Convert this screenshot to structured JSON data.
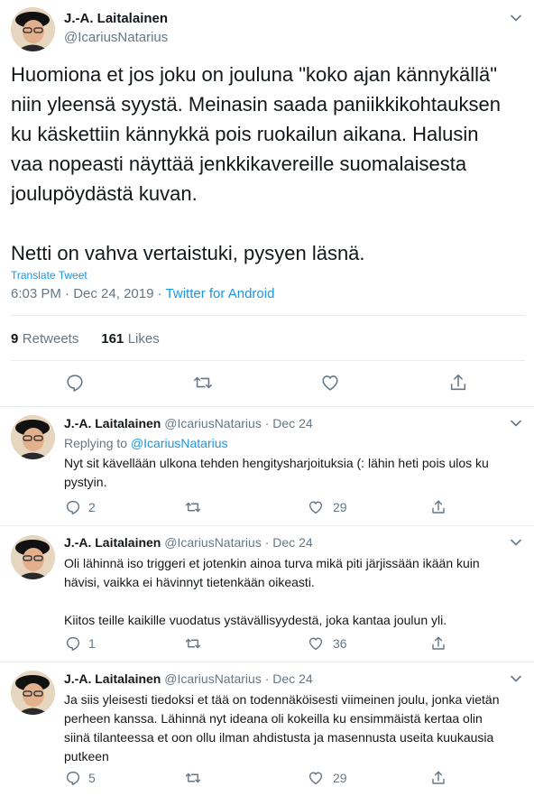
{
  "main_tweet": {
    "author_name": "J.-A. Laitalainen",
    "author_handle": "@IcariusNatarius",
    "text": "Huomiona et jos joku on jouluna \"koko ajan kännykällä\"\nniin yleensä syystä. Meinasin saada paniikkikohtauksen\nku käskettiin kännykkä pois ruokailun aikana. Halusin\nvaa nopeasti näyttää jenkkikavereille suomalaisesta\njoulupöydästä kuvan.\n\nNetti on vahva vertaistuki, pysyen läsnä.",
    "translate_label": "Translate Tweet",
    "time": "6:03 PM",
    "date": "Dec 24, 2019",
    "source": "Twitter for Android",
    "retweets_count": "9",
    "retweets_label": "Retweets",
    "likes_count": "161",
    "likes_label": "Likes"
  },
  "replies": [
    {
      "author_name": "J.-A. Laitalainen",
      "author_handle": "@IcariusNatarius",
      "date": "Dec 24",
      "replying_label": "Replying to",
      "replying_handle": "@IcariusNatarius",
      "text": "Nyt sit kävellään ulkona tehden hengitysharjoituksia (: lähin heti pois ulos ku\npystyin.",
      "reply_count": "2",
      "retweet_count": "",
      "like_count": "29"
    },
    {
      "author_name": "J.-A. Laitalainen",
      "author_handle": "@IcariusNatarius",
      "date": "Dec 24",
      "text": "Oli lähinnä iso triggeri et jotenkin ainoa turva mikä piti järjissään ikään kuin\nhävisi, vaikka ei hävinnyt tietenkään oikeasti.\n\nKiitos teille kaikille vuodatus ystävällisyydestä, joka kantaa joulun yli.",
      "reply_count": "1",
      "retweet_count": "",
      "like_count": "36"
    },
    {
      "author_name": "J.-A. Laitalainen",
      "author_handle": "@IcariusNatarius",
      "date": "Dec 24",
      "text": "Ja siis yleisesti tiedoksi et tää on todennäköisesti viimeinen joulu, jonka vietän\nperheen kanssa. Lähinnä nyt ideana oli kokeilla ku ensimmäistä kertaa olin\nsiinä tilanteessa et oon ollu ilman ahdistusta ja masennusta useita kuukausia\nputkeen",
      "reply_count": "5",
      "retweet_count": "",
      "like_count": "29"
    }
  ],
  "meta_separator": "·",
  "colors": {
    "link": "#1b95e0",
    "muted": "#657786",
    "text": "#14171a",
    "divider": "#e6ecf0"
  },
  "icons": [
    "avatar",
    "chevron-down-icon",
    "reply-icon",
    "retweet-icon",
    "like-icon",
    "share-icon"
  ]
}
